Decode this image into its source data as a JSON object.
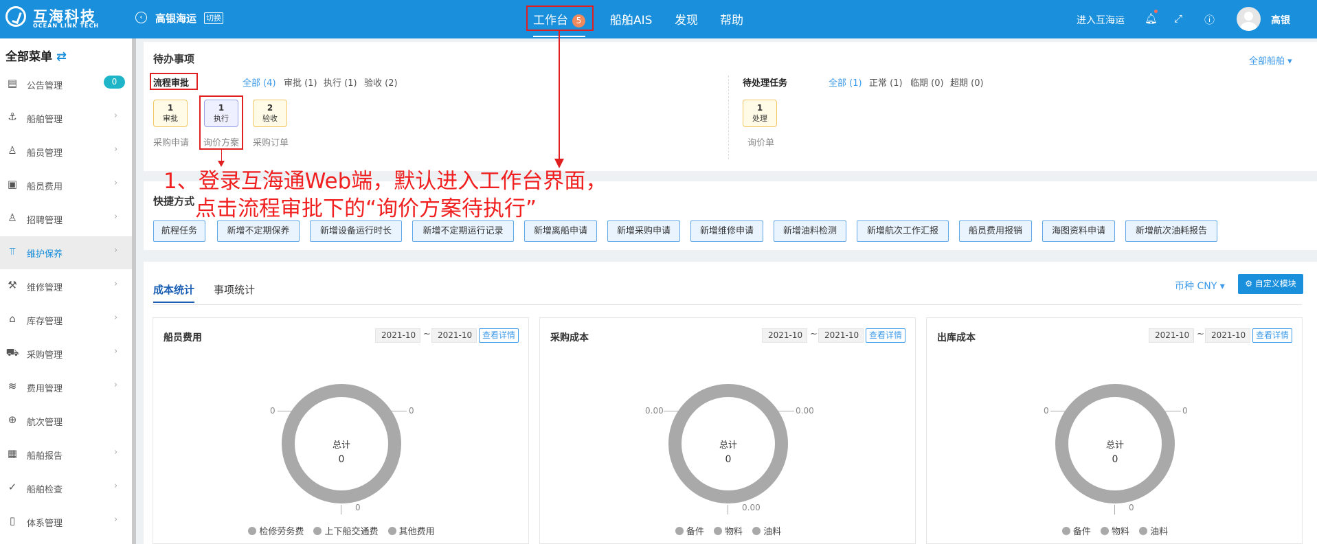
{
  "brand": {
    "name_cn": "互海科技",
    "name_en": "OCEAN LINK TECH"
  },
  "header": {
    "company": "高银海运",
    "switch_label": "切换",
    "nav": [
      {
        "label": "工作台",
        "badge": "5"
      },
      {
        "label": "船舶AIS"
      },
      {
        "label": "发现"
      },
      {
        "label": "帮助"
      }
    ],
    "enter_label": "进入互海运",
    "username": "高银"
  },
  "sidebar": {
    "title": "全部菜单",
    "items": [
      {
        "label": "公告管理",
        "icon": "book-icon",
        "badge": "0"
      },
      {
        "label": "船舶管理",
        "icon": "anchor-icon"
      },
      {
        "label": "船员管理",
        "icon": "user-icon"
      },
      {
        "label": "船员费用",
        "icon": "wallet-icon"
      },
      {
        "label": "招聘管理",
        "icon": "recruit-icon"
      },
      {
        "label": "维护保养",
        "icon": "maintenance-icon",
        "active": true
      },
      {
        "label": "维修管理",
        "icon": "wrench-icon"
      },
      {
        "label": "库存管理",
        "icon": "warehouse-icon"
      },
      {
        "label": "采购管理",
        "icon": "cart-icon"
      },
      {
        "label": "费用管理",
        "icon": "coins-icon"
      },
      {
        "label": "航次管理",
        "icon": "globe-icon"
      },
      {
        "label": "船舶报告",
        "icon": "calendar-icon"
      },
      {
        "label": "船舶检查",
        "icon": "check-circle-icon"
      },
      {
        "label": "体系管理",
        "icon": "document-icon"
      }
    ]
  },
  "todo": {
    "title": "待办事项",
    "all_ships": "全部船舶",
    "approval": {
      "label": "流程审批",
      "filters": [
        "全部 (4)",
        "审批 (1)",
        "执行 (1)",
        "验收 (2)"
      ],
      "tasks": [
        {
          "count": "1",
          "type": "审批",
          "caption": "采购申请"
        },
        {
          "count": "1",
          "type": "执行",
          "caption": "询价方案"
        },
        {
          "count": "2",
          "type": "验收",
          "caption": "采购订单"
        }
      ]
    },
    "pending": {
      "label": "待处理任务",
      "filters": [
        "全部 (1)",
        "正常 (1)",
        "临期 (0)",
        "超期 (0)"
      ],
      "tasks": [
        {
          "count": "1",
          "type": "处理",
          "caption": "询价单"
        }
      ]
    }
  },
  "annotation": {
    "line1": "1、登录互海通Web端，默认进入工作台界面，",
    "line2": "点击流程审批下的“询价方案待执行”"
  },
  "shortcuts": {
    "title": "快捷方式",
    "buttons": [
      "航程任务",
      "新增不定期保养",
      "新增设备运行时长",
      "新增不定期运行记录",
      "新增离船申请",
      "新增采购申请",
      "新增维修申请",
      "新增油料检测",
      "新增航次工作汇报",
      "船员费用报销",
      "海图资料申请",
      "新增航次油耗报告"
    ]
  },
  "stats": {
    "tabs": [
      "成本统计",
      "事项统计"
    ],
    "currency": "币种 CNY",
    "custom_label": "自定义模块",
    "cards": [
      {
        "title": "船员费用",
        "date_from": "2021-10",
        "date_to": "2021-10",
        "detail": "查看详情",
        "total_label": "总计",
        "total": "0",
        "lead_left": "0",
        "lead_right": "0",
        "lead_bottom": "0",
        "legend": [
          "检修劳务费",
          "上下船交通费",
          "其他费用"
        ]
      },
      {
        "title": "采购成本",
        "date_from": "2021-10",
        "date_to": "2021-10",
        "detail": "查看详情",
        "total_label": "总计",
        "total": "0",
        "lead_left": "0.00",
        "lead_right": "0.00",
        "lead_bottom": "0.00",
        "legend": [
          "备件",
          "物料",
          "油料"
        ]
      },
      {
        "title": "出库成本",
        "date_from": "2021-10",
        "date_to": "2021-10",
        "detail": "查看详情",
        "total_label": "总计",
        "total": "0",
        "lead_left": "0",
        "lead_right": "0",
        "lead_bottom": "0",
        "legend": [
          "备件",
          "物料",
          "油料"
        ]
      }
    ]
  }
}
